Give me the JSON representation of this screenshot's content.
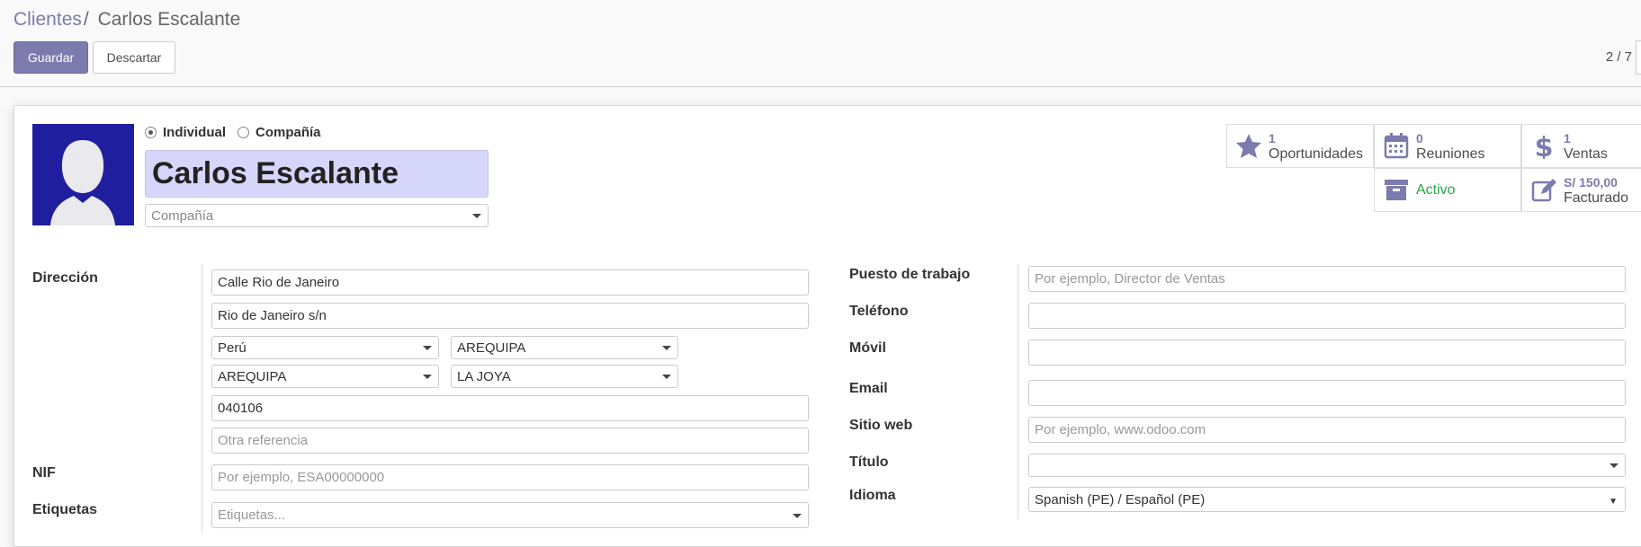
{
  "breadcrumb": {
    "parent": "Clientes",
    "separator": "/",
    "current": "Carlos Escalante"
  },
  "actions": {
    "save": "Guardar",
    "discard": "Descartar"
  },
  "pager": {
    "value": "2 / 7"
  },
  "partner": {
    "type_individual": "Individual",
    "type_company": "Compañía",
    "selected_type": "Individual",
    "name": "Carlos Escalante",
    "company_placeholder": "Compañía"
  },
  "stats": {
    "opportunities": {
      "value": "1",
      "label": "Oportunidades",
      "icon": "star-icon"
    },
    "meetings": {
      "value": "0",
      "label": "Reuniones",
      "icon": "calendar-icon"
    },
    "sales": {
      "value": "1",
      "label": "Ventas",
      "icon": "dollar-icon"
    },
    "active": {
      "label": "Activo",
      "icon": "archive-icon"
    },
    "invoiced": {
      "value": "S/ 150,00",
      "label": "Facturado",
      "icon": "edit-icon"
    }
  },
  "left": {
    "address_label": "Dirección",
    "street": "Calle Rio de Janeiro",
    "street2": "Rio de Janeiro s/n",
    "country": "Perú",
    "state": "AREQUIPA",
    "province": "AREQUIPA",
    "district": "LA JOYA",
    "zip": "040106",
    "other_ref_placeholder": "Otra referencia",
    "nif_label": "NIF",
    "nif_placeholder": "Por ejemplo, ESA00000000",
    "tags_label": "Etiquetas",
    "tags_placeholder": "Etiquetas..."
  },
  "right": {
    "job_label": "Puesto de trabajo",
    "job_placeholder": "Por ejemplo, Director de Ventas",
    "phone_label": "Teléfono",
    "phone_value": "",
    "mobile_label": "Móvil",
    "mobile_value": "",
    "email_label": "Email",
    "email_value": "",
    "website_label": "Sitio web",
    "website_placeholder": "Por ejemplo, www.odoo.com",
    "title_label": "Título",
    "title_value": "",
    "lang_label": "Idioma",
    "lang_value": "Spanish (PE) / Español (PE)"
  },
  "colors": {
    "accent": "#7c7bad",
    "name_bg": "#d6d5fa",
    "active": "#28a745",
    "avatar_bg": "#1e1e9e"
  }
}
